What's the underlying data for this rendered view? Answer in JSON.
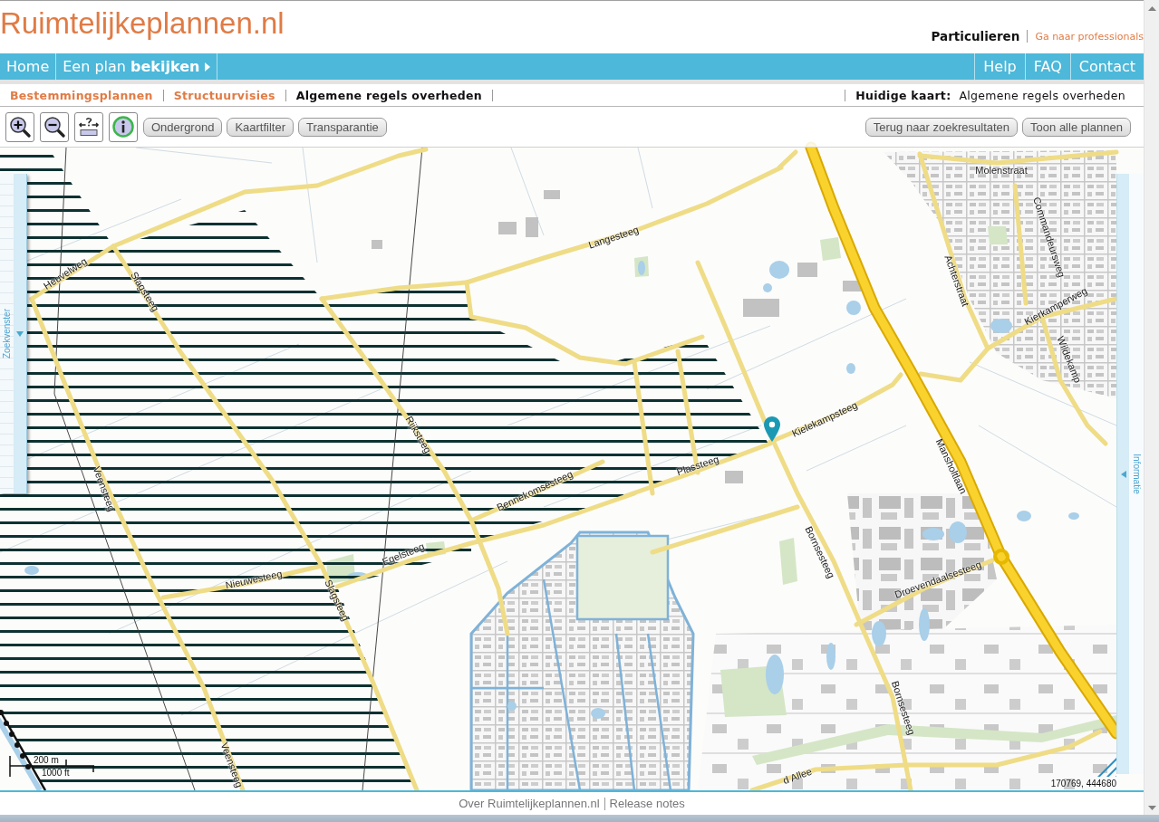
{
  "header": {
    "logo": "Ruimtelijkeplannen.nl",
    "audience": "Particulieren",
    "switch_link": "Ga naar professionals"
  },
  "nav": {
    "left": [
      {
        "label": "Home",
        "kind": "link"
      },
      {
        "label": "Een plan **bekijken**",
        "kind": "menu"
      }
    ],
    "right": [
      {
        "label": "Help"
      },
      {
        "label": "FAQ"
      },
      {
        "label": "Contact"
      }
    ]
  },
  "subnav": {
    "tabs": [
      {
        "label": "Bestemmingsplannen",
        "selected": false
      },
      {
        "label": "Structuurvisies",
        "selected": false
      },
      {
        "label": "Algemene regels overheden",
        "selected": true
      }
    ],
    "current_label": "Huidige kaart:",
    "current_value": "Algemene regels overheden"
  },
  "toolbar": {
    "buttons_left": [
      "Ondergrond",
      "Kaartfilter",
      "Transparantie"
    ],
    "buttons_right": [
      "Terug naar zoekresultaten",
      "Toon alle plannen"
    ]
  },
  "map": {
    "street_labels": [
      "Heuvelweg",
      "Slagsteeg",
      "Veensteeg",
      "Rijksteeg",
      "Langesteeg",
      "Bennekomsesteeg",
      "Plassteeg",
      "Kielekampsteeg",
      "Nieuwesteeg",
      "Egelsteeg",
      "Slagsteeg",
      "Bornsesteeg",
      "Droevendaalsesteeg",
      "Mansholtlaan",
      "Bornsesteeg",
      "Achterstraat",
      "Commandeursweg",
      "Kierkamperweg",
      "Wildekamp",
      "Molenstraat",
      "Veensteeg",
      "d Allee"
    ],
    "scale": [
      "200 m",
      "1000 ft"
    ],
    "coordinates": "170769, 444680"
  },
  "panels": {
    "left": "Zoekvenster",
    "right": "Informatie"
  },
  "footer": {
    "links": [
      "Over Ruimtelijkeplannen.nl",
      "Release notes"
    ]
  }
}
